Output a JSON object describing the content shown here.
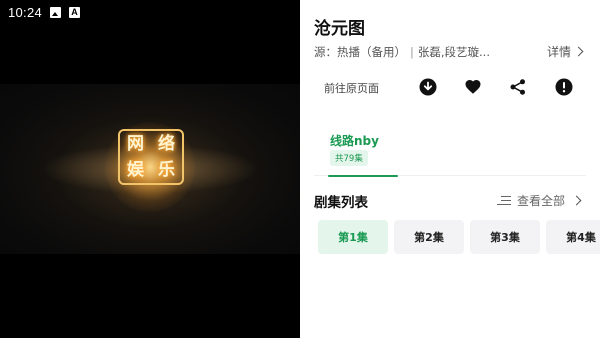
{
  "status_bar": {
    "time": "10:24"
  },
  "video": {
    "logo_chars": [
      "网",
      "络",
      "娱",
      "乐"
    ]
  },
  "info": {
    "title": "沧元图",
    "meta_source": "源：热播（备用）",
    "meta_separator": "|",
    "meta_cast": "张磊,段艺璇...",
    "details_label": "详情",
    "goto_source_label": "前往原页面",
    "actions": [
      {
        "name": "download",
        "icon": "download-icon"
      },
      {
        "name": "favorite",
        "icon": "heart-icon"
      },
      {
        "name": "share",
        "icon": "share-icon"
      },
      {
        "name": "report",
        "icon": "alert-icon"
      }
    ]
  },
  "route_tab": {
    "label": "线路nby",
    "badge": "共79集"
  },
  "episodes_section": {
    "title": "剧集列表",
    "view_all_label": "查看全部",
    "items": [
      {
        "label": "第1集",
        "active": true
      },
      {
        "label": "第2集",
        "active": false
      },
      {
        "label": "第3集",
        "active": false
      },
      {
        "label": "第4集",
        "active": false
      }
    ]
  },
  "colors": {
    "accent": "#1a9a52",
    "accent_bg": "#e4f5eb",
    "chip_bg": "#f3f3f5"
  }
}
